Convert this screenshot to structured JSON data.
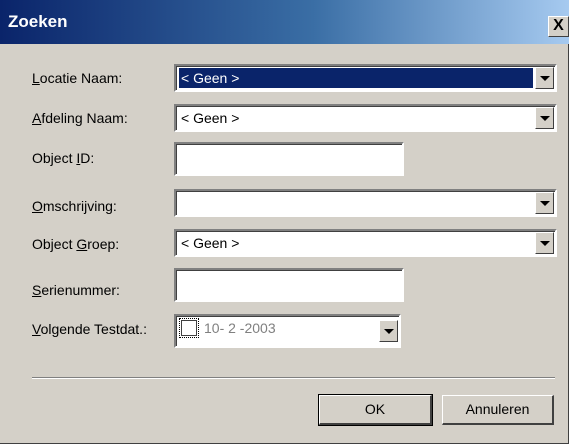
{
  "dialog": {
    "title": "Zoeken",
    "close_label": "X"
  },
  "fields": {
    "locatie_naam": {
      "label_access": "L",
      "label_rest": "ocatie Naam:",
      "value": "< Geen >"
    },
    "afdeling_naam": {
      "label_access": "A",
      "label_rest": "fdeling Naam:",
      "value": "< Geen >"
    },
    "object_id": {
      "label_pre": "Object ",
      "label_access": "I",
      "label_rest": "D:",
      "value": ""
    },
    "omschrijving": {
      "label_access": "O",
      "label_rest": "mschrijving:",
      "value": ""
    },
    "object_groep": {
      "label_pre": "Object ",
      "label_access": "G",
      "label_rest": "roep:",
      "value": "< Geen >"
    },
    "serienummer": {
      "label_access": "S",
      "label_rest": "erienummer:",
      "value": ""
    },
    "volgende_testdat": {
      "label_access": "V",
      "label_rest": "olgende Testdat.:",
      "value": "10- 2 -2003",
      "checked": false
    }
  },
  "buttons": {
    "ok": "OK",
    "annuleren": "Annuleren"
  },
  "colors": {
    "title_bar_start": "#0a246a",
    "title_bar_end": "#a6caf0",
    "selection": "#0a246a",
    "face": "#d4d0c8"
  }
}
